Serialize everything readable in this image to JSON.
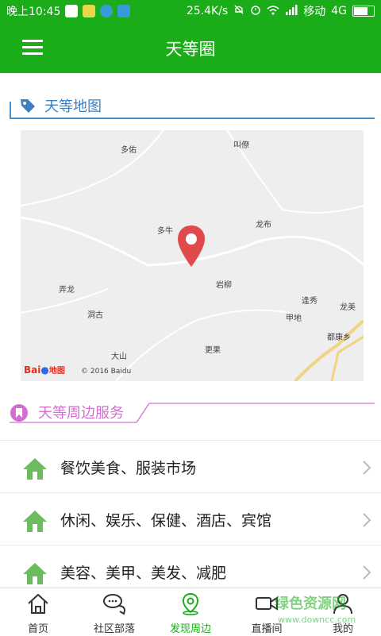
{
  "status_bar": {
    "time": "晚上10:45",
    "speed": "25.4K/s",
    "carrier": "移动",
    "network": "4G",
    "icons": [
      "qq-icon",
      "app-icon",
      "bird-icon",
      "square-app-icon",
      "mute-icon",
      "alarm-icon",
      "wifi-icon",
      "signal-icon",
      "battery-icon"
    ]
  },
  "header": {
    "title": "天等圈",
    "menu_icon": "hamburger-menu-icon"
  },
  "map_section": {
    "title": "天等地图",
    "icon": "tag-icon",
    "place_labels": [
      "多佑",
      "叫僚",
      "多牛",
      "龙布",
      "岩柳",
      "弄龙",
      "洞古",
      "逢秀",
      "甲地",
      "龙美",
      "都康乡",
      "大山",
      "更果"
    ],
    "logo_text": "Bai",
    "logo_text2": "地图",
    "copyright": "© 2016 Baidu"
  },
  "services_section": {
    "title": "天等周边服务",
    "icon": "bookmark-circle-icon",
    "items": [
      {
        "label": "餐饮美食、服装市场"
      },
      {
        "label": "休闲、娱乐、保健、酒店、宾馆"
      },
      {
        "label": "美容、美甲、美发、减肥"
      }
    ]
  },
  "tabs": [
    {
      "label": "首页",
      "icon": "home-icon",
      "active": false
    },
    {
      "label": "社区部落",
      "icon": "chat-bubbles-icon",
      "active": false
    },
    {
      "label": "发现周边",
      "icon": "location-pin-icon",
      "active": true
    },
    {
      "label": "直播间",
      "icon": "video-camera-icon",
      "active": false
    },
    {
      "label": "我的",
      "icon": "user-icon",
      "active": false
    }
  ],
  "watermark": {
    "text": "绿色资源网",
    "url": "www.downcc.com"
  },
  "colors": {
    "primary": "#1aad19",
    "map_section_accent": "#3d7fbf",
    "services_section_accent": "#d070cf",
    "home_icon_green": "#6dbb5f",
    "pin_red": "#e04a4a"
  }
}
